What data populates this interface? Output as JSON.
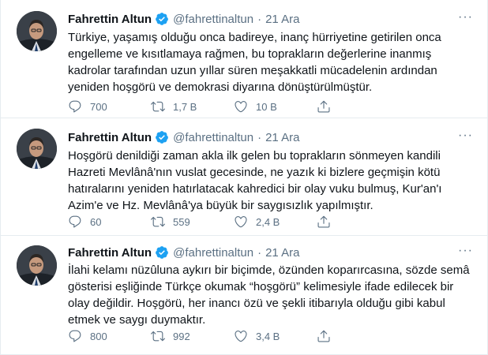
{
  "tweets": [
    {
      "name": "Fahrettin Altun",
      "handle": "@fahrettinaltun",
      "separator": "·",
      "time": "21 Ara",
      "more": "···",
      "text": "Türkiye, yaşamış olduğu onca badireye, inanç hürriyetine getirilen onca engelleme ve kısıtlamaya rağmen, bu toprakların değerlerine inanmış kadrolar tarafından uzun yıllar süren meşakkatli mücadelenin ardından yeniden hoşgörü ve demokrasi diyarına dönüştürülmüştür.",
      "replies": "700",
      "retweets": "1,7 B",
      "likes": "10 B"
    },
    {
      "name": "Fahrettin Altun",
      "handle": "@fahrettinaltun",
      "separator": "·",
      "time": "21 Ara",
      "more": "···",
      "text": "Hoşgörü denildiği zaman akla ilk gelen bu toprakların sönmeyen kandili Hazreti Mevlânâ'nın vuslat gecesinde, ne yazık ki bizlere geçmişin kötü hatıralarını yeniden hatırlatacak kahredici bir olay vuku bulmuş, Kur'an'ı Azim'e ve Hz. Mevlânâ'ya büyük bir saygısızlık yapılmıştır.",
      "replies": "60",
      "retweets": "559",
      "likes": "2,4 B"
    },
    {
      "name": "Fahrettin Altun",
      "handle": "@fahrettinaltun",
      "separator": "·",
      "time": "21 Ara",
      "more": "···",
      "text": "İlahi kelamı nüzûluna aykırı bir biçimde, özünden koparırcasına, sözde semâ gösterisi eşliğinde Türkçe okumak “hoşgörü” kelimesiyle ifade edilecek bir olay değildir. Hoşgörü, her inancı özü ve şekli itibarıyla olduğu gibi kabul etmek ve saygı duymaktır.",
      "replies": "800",
      "retweets": "992",
      "likes": "3,4 B"
    }
  ],
  "colors": {
    "verified": "#1da1f2",
    "secondary_text": "#5b7083",
    "divider": "#e6ecf0"
  },
  "icons": [
    "verified-icon",
    "more-icon",
    "reply-icon",
    "retweet-icon",
    "like-icon",
    "share-icon"
  ]
}
